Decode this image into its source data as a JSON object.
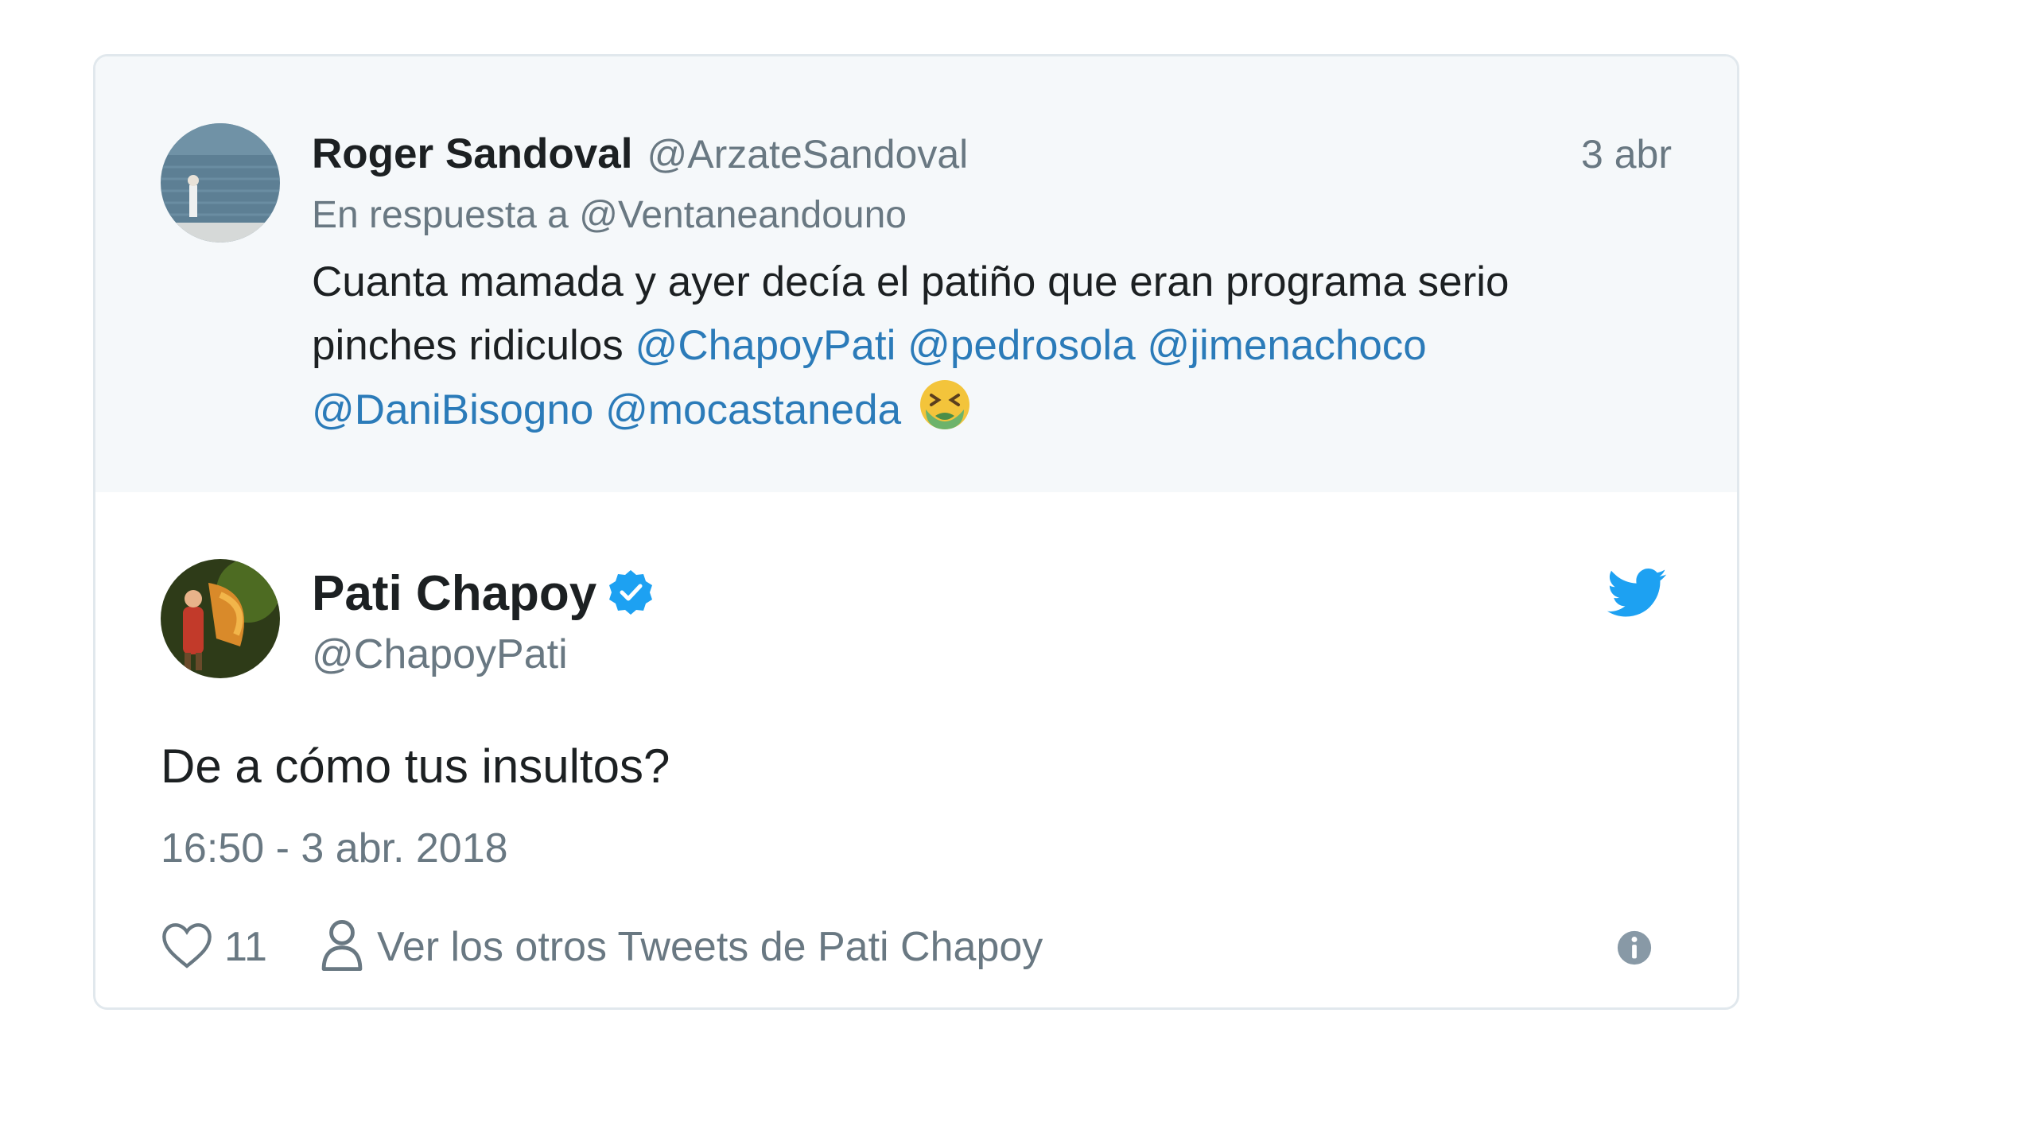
{
  "parent_tweet": {
    "author_name": "Roger Sandoval",
    "author_handle": "@ArzateSandoval",
    "time": "3 abr",
    "reply_prefix": "En respuesta a",
    "reply_to": "@Ventaneandouno",
    "text_line1": "Cuanta mamada y ayer decía el patiño que eran programa serio",
    "text_line2_plain": "pinches ridiculos",
    "mentions": [
      "@ChapoyPati",
      "@pedrosola",
      "@jimenachoco",
      "@DaniBisogno",
      "@mocastaneda"
    ],
    "emoji_icon": "nauseated-face-icon"
  },
  "main_tweet": {
    "author_name": "Pati Chapoy",
    "author_handle": "@ChapoyPati",
    "verified": true,
    "text": "De a cómo tus insultos?",
    "datetime": "16:50 - 3 abr. 2018",
    "likes": "11",
    "more_tweets_label": "Ver los otros Tweets de Pati Chapoy"
  },
  "colors": {
    "brand_blue": "#1da1f2",
    "link": "#2b7bb9",
    "muted": "#697882",
    "parent_bg": "#f5f8fa",
    "border": "#e1e8ed"
  }
}
